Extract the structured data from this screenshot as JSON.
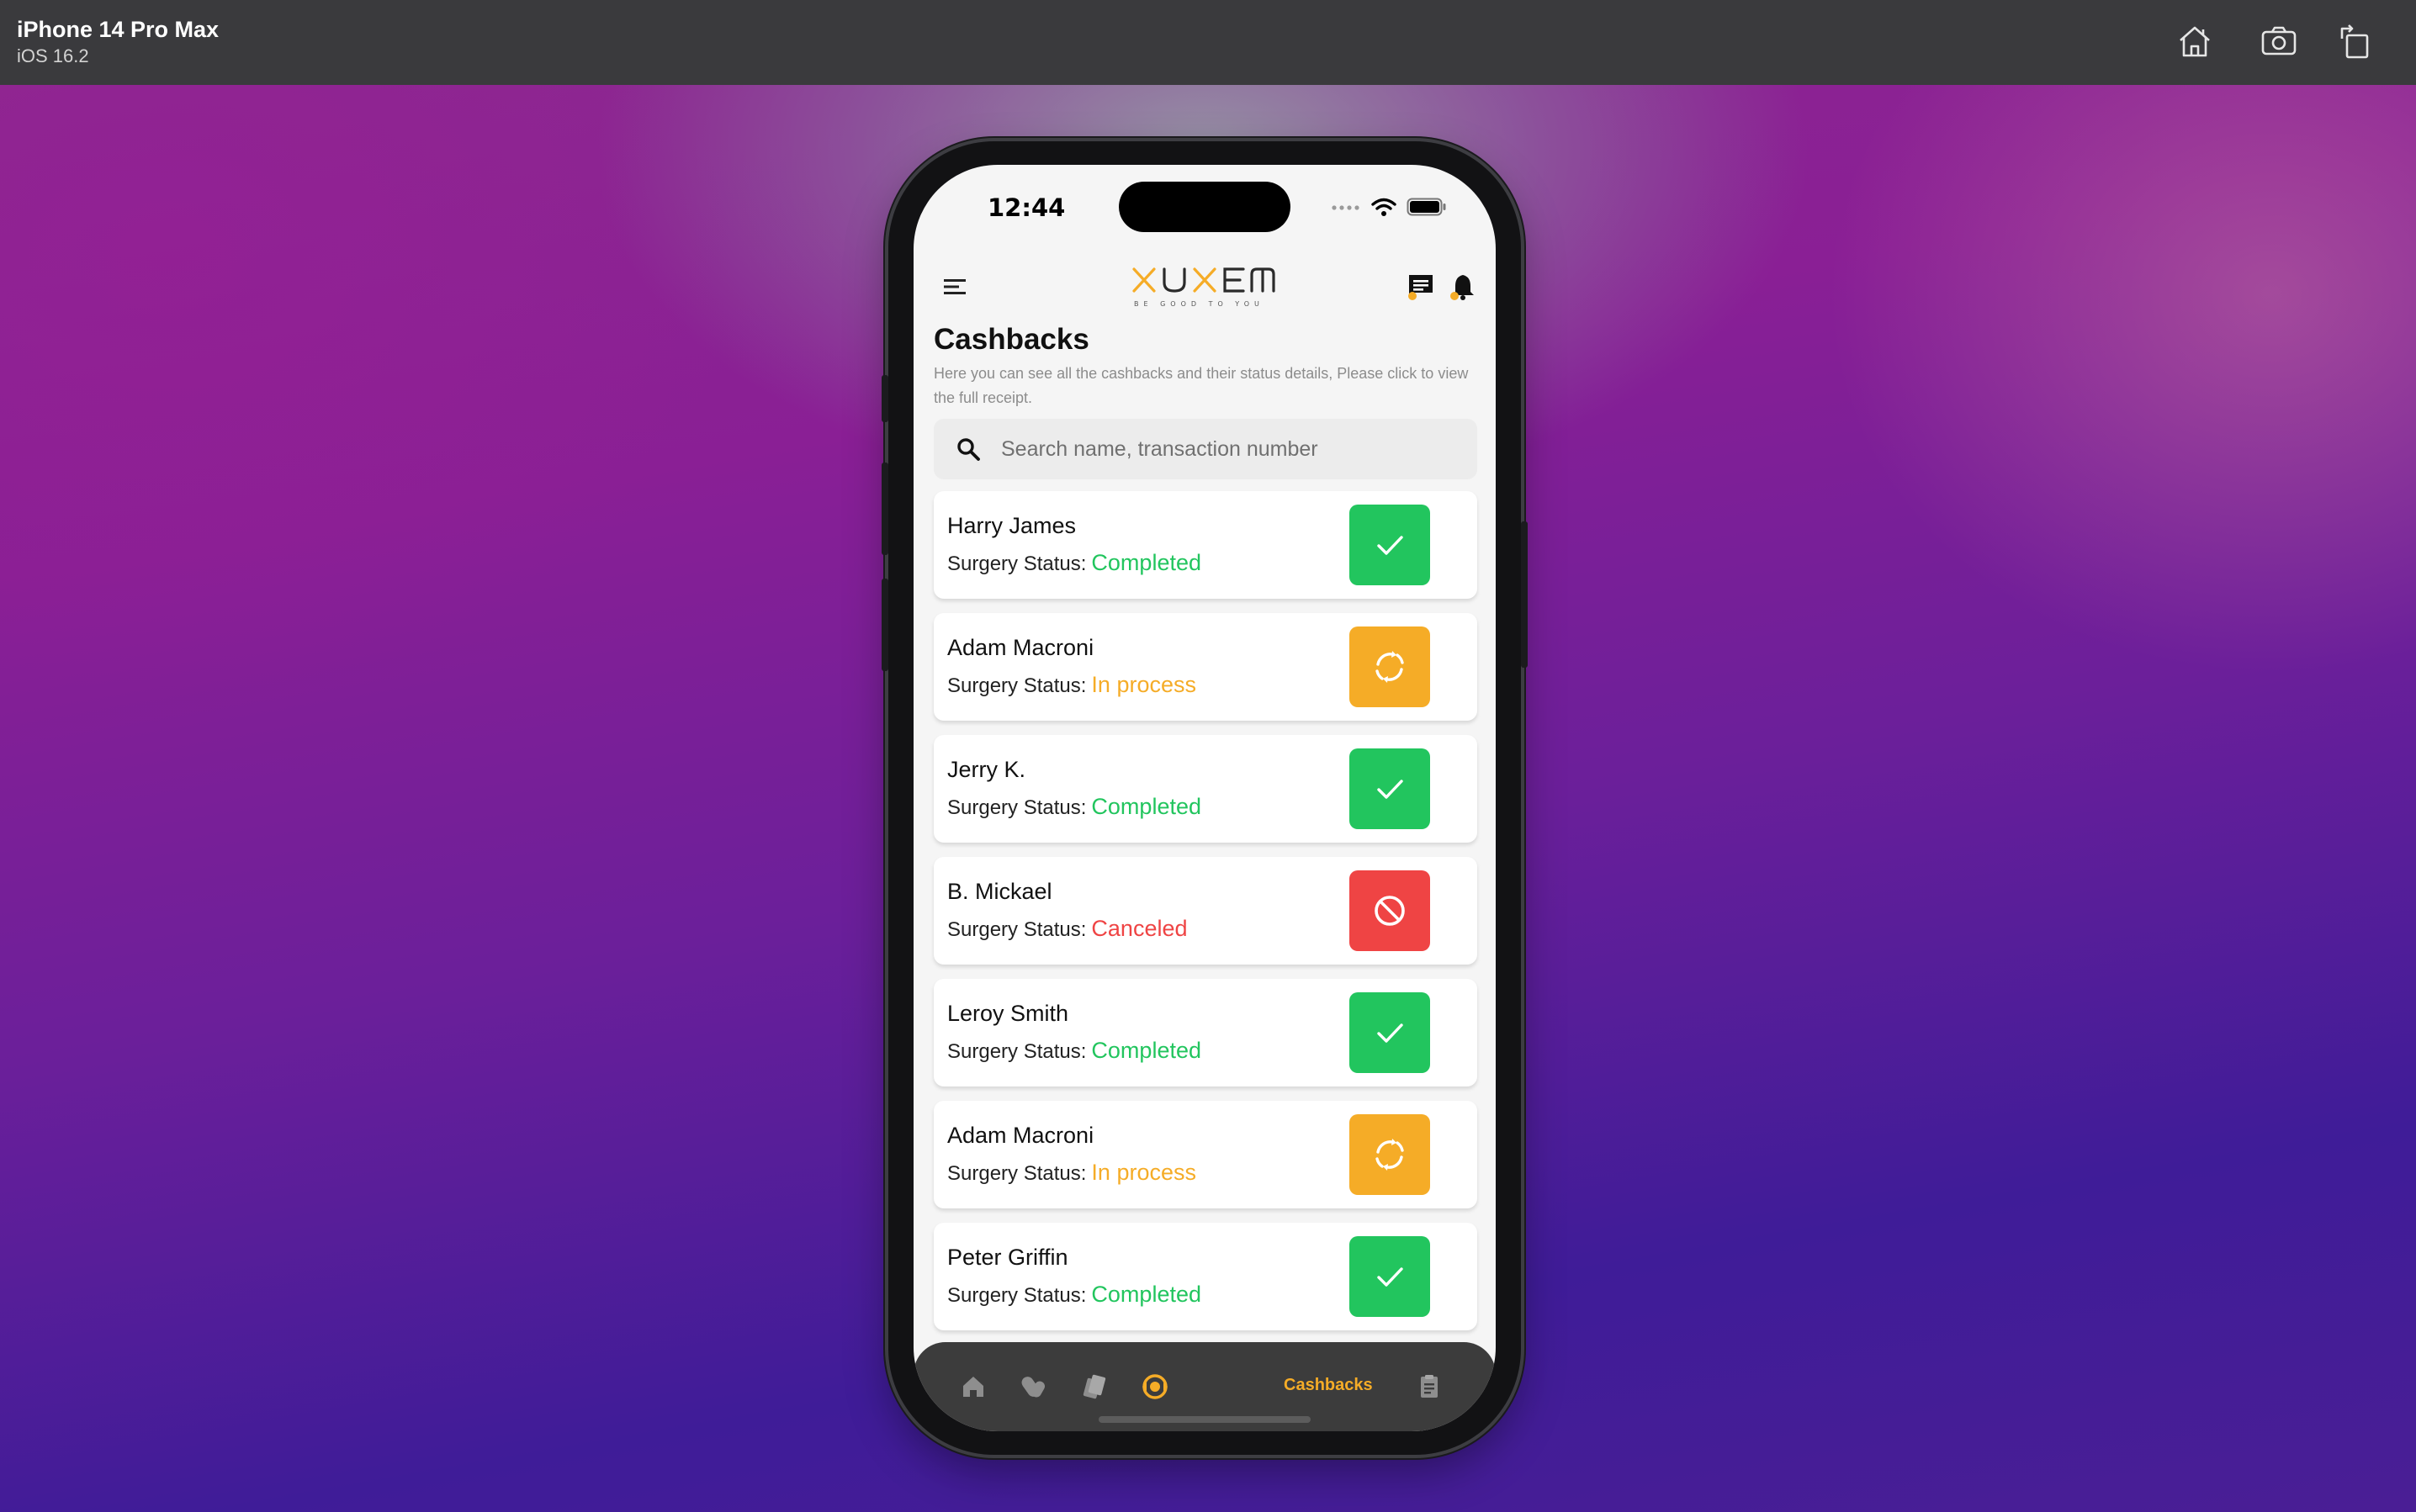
{
  "simulator": {
    "device_name": "iPhone 14 Pro Max",
    "os_version": "iOS 16.2",
    "tools": [
      "home-icon",
      "screenshot-icon",
      "rotate-icon"
    ]
  },
  "status_bar": {
    "time": "12:44"
  },
  "header": {
    "logo_text": "XUXEM",
    "logo_tagline": "BE GOOD TO YOU",
    "menu_icon": "hamburger-menu-icon",
    "chat_icon": "chat-icon",
    "bell_icon": "bell-icon"
  },
  "page": {
    "title": "Cashbacks",
    "subtitle": "Here you can see all the cashbacks and their status details, Please click to view the full receipt."
  },
  "search": {
    "placeholder": "Search name, transaction number",
    "value": ""
  },
  "colors": {
    "completed": "#22c55e",
    "in_process": "#f5ac27",
    "canceled": "#ef4444",
    "accent": "#f5ac27"
  },
  "cashbacks": [
    {
      "name": "Harry James",
      "status_label": "Surgery Status:",
      "status": "Completed",
      "icon": "check-icon"
    },
    {
      "name": "Adam Macroni",
      "status_label": "Surgery Status:",
      "status": "In process",
      "icon": "refresh-icon"
    },
    {
      "name": "Jerry K.",
      "status_label": "Surgery Status:",
      "status": "Completed",
      "icon": "check-icon"
    },
    {
      "name": "B. Mickael",
      "status_label": "Surgery Status:",
      "status": "Canceled",
      "icon": "block-icon"
    },
    {
      "name": "Leroy Smith",
      "status_label": "Surgery Status:",
      "status": "Completed",
      "icon": "check-icon"
    },
    {
      "name": "Adam Macroni",
      "status_label": "Surgery Status:",
      "status": "In process",
      "icon": "refresh-icon"
    },
    {
      "name": "Peter Griffin",
      "status_label": "Surgery Status:",
      "status": "Completed",
      "icon": "check-icon"
    }
  ],
  "tabbar": {
    "tabs": [
      "home-icon",
      "pills-icon",
      "cards-icon",
      "cashback-icon",
      "receipt-icon"
    ],
    "active_label": "Cashbacks"
  }
}
